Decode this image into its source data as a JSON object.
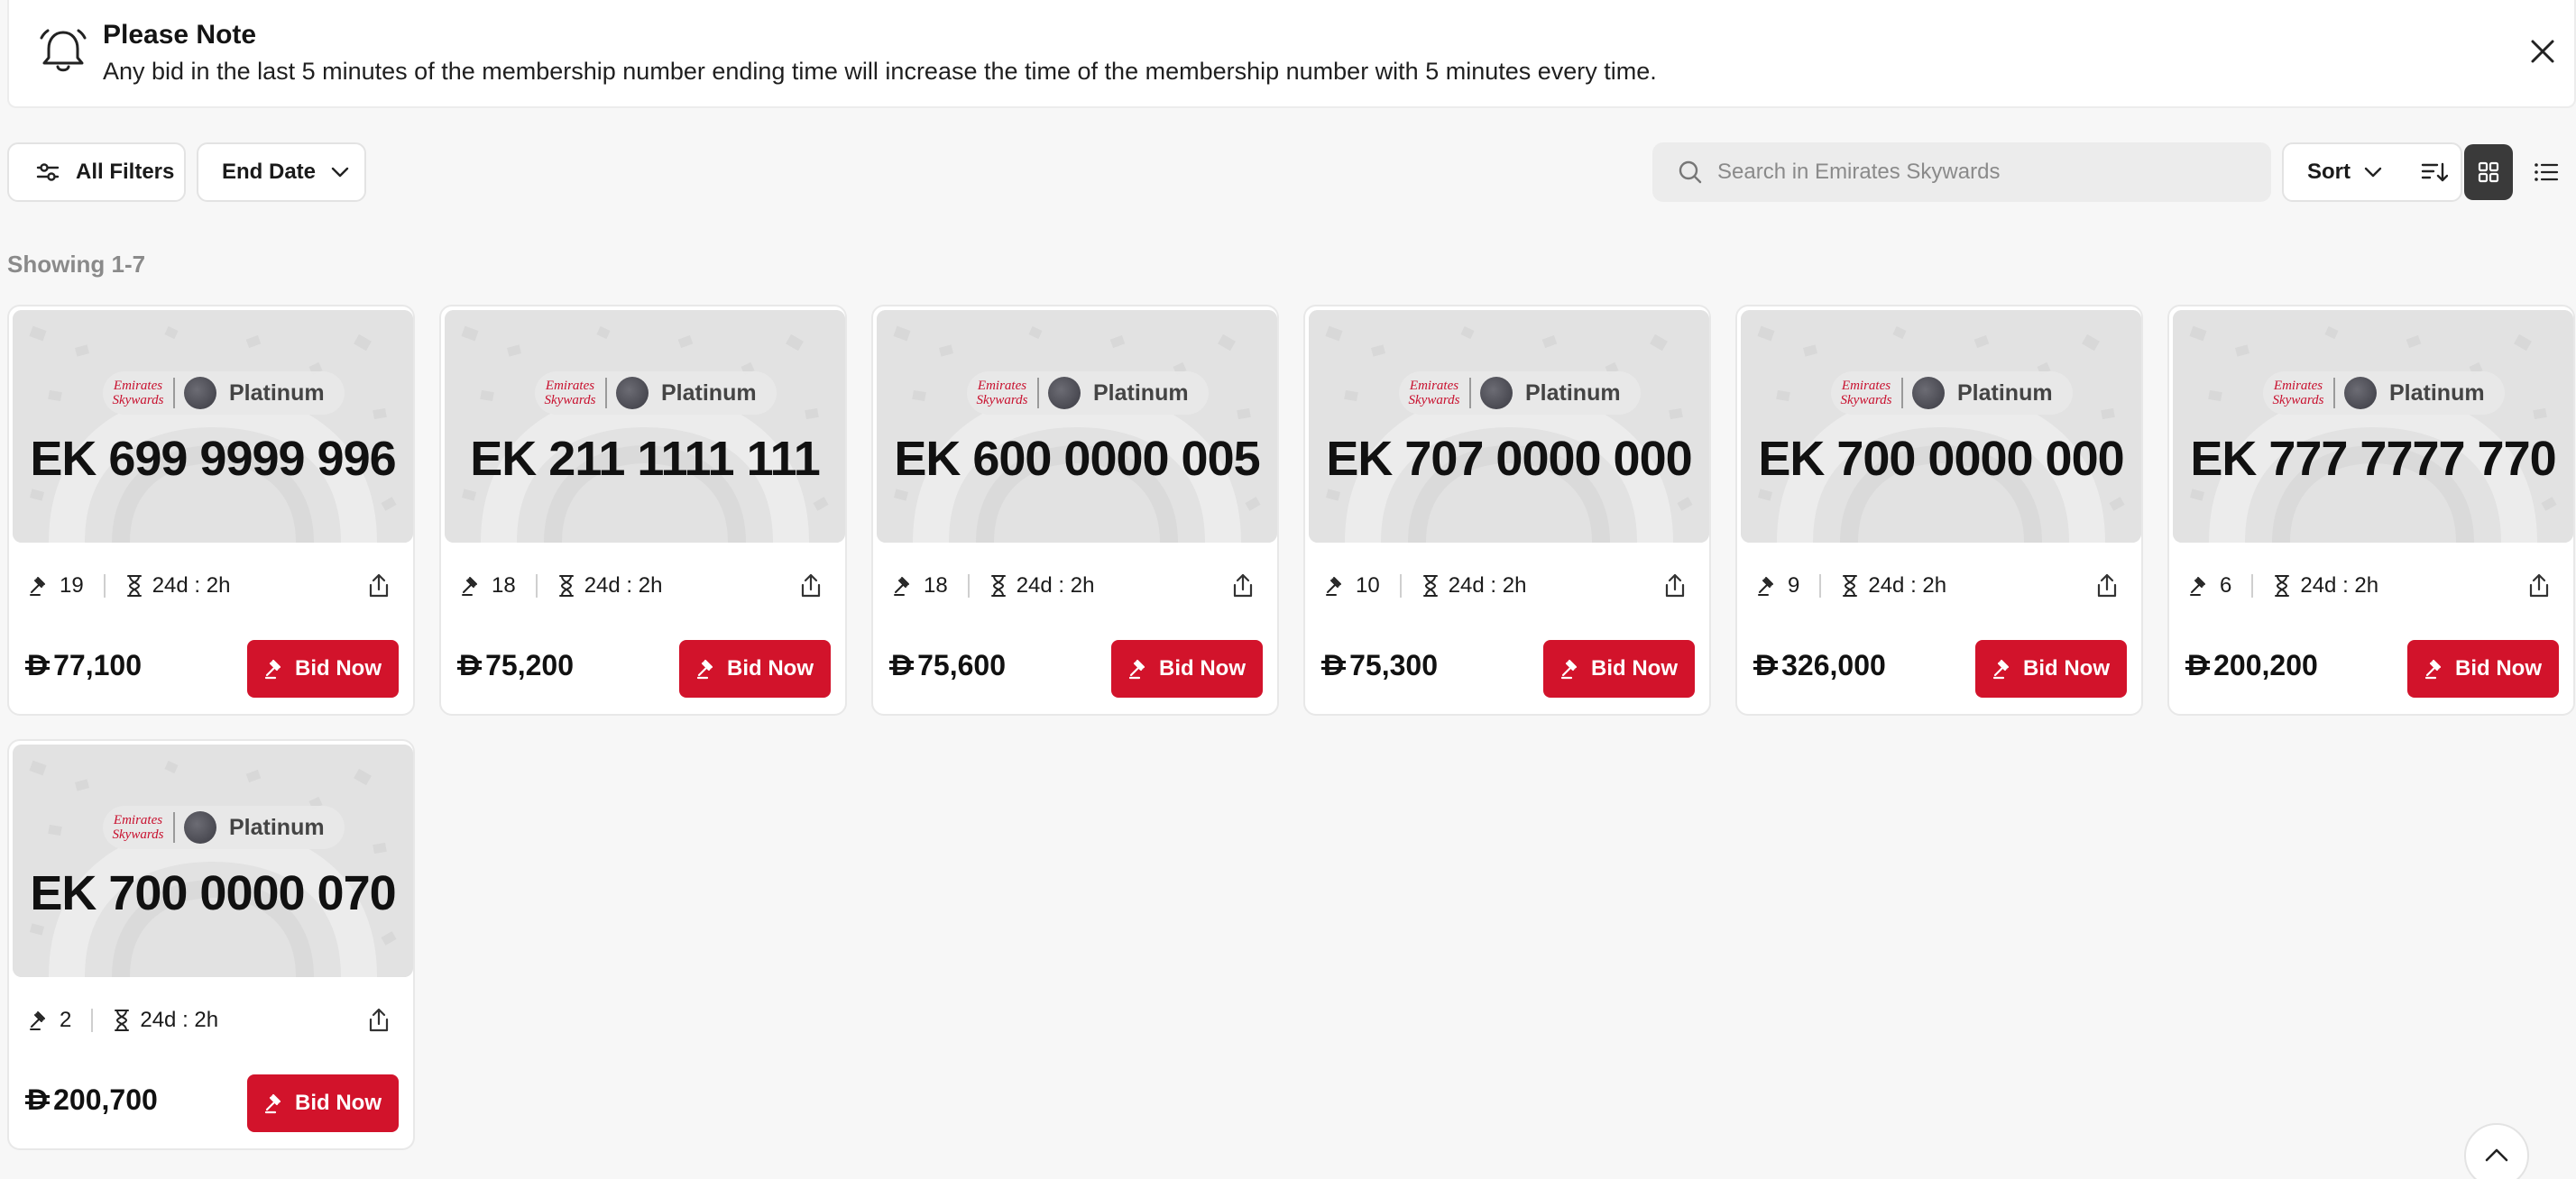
{
  "notice": {
    "title": "Please Note",
    "text": "Any bid in the last 5 minutes of the membership number ending time will increase the time of the membership number with 5 minutes every time."
  },
  "toolbar": {
    "filters_label": "All Filters",
    "end_date_label": "End Date",
    "search_placeholder": "Search in Emirates Skywards",
    "sort_label": "Sort"
  },
  "showing": "Showing 1-7",
  "brand": {
    "line1": "Emirates",
    "line2": "Skywards"
  },
  "bid_label": "Bid Now",
  "colors": {
    "accent": "#d2132b",
    "brand_red": "#c8102e"
  },
  "cards": [
    {
      "number": "EK 699 9999 996",
      "tier": "Platinum",
      "bids": "19",
      "time": "24d : 2h",
      "price": "77,100"
    },
    {
      "number": "EK 211 1111 111",
      "tier": "Platinum",
      "bids": "18",
      "time": "24d : 2h",
      "price": "75,200"
    },
    {
      "number": "EK 600 0000 005",
      "tier": "Platinum",
      "bids": "18",
      "time": "24d : 2h",
      "price": "75,600"
    },
    {
      "number": "EK 707 0000 000",
      "tier": "Platinum",
      "bids": "10",
      "time": "24d : 2h",
      "price": "75,300"
    },
    {
      "number": "EK 700 0000 000",
      "tier": "Platinum",
      "bids": "9",
      "time": "24d : 2h",
      "price": "326,000"
    },
    {
      "number": "EK 777 7777 770",
      "tier": "Platinum",
      "bids": "6",
      "time": "24d : 2h",
      "price": "200,200"
    },
    {
      "number": "EK 700 0000 070",
      "tier": "Platinum",
      "bids": "2",
      "time": "24d : 2h",
      "price": "200,700"
    }
  ]
}
